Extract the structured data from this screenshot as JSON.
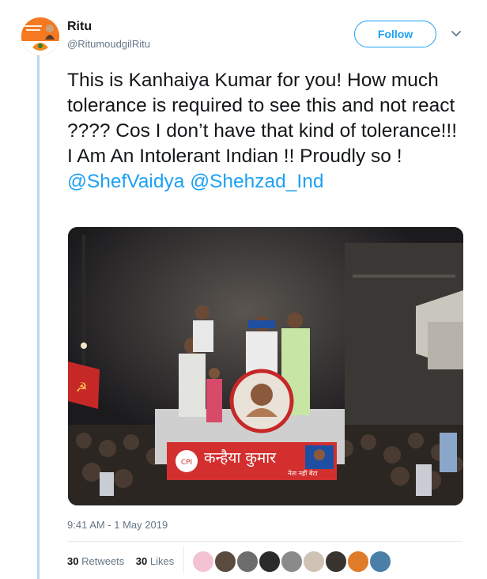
{
  "author": {
    "name": "Ritu",
    "handle": "@RitumoudgilRitu"
  },
  "follow_label": "Follow",
  "tweet": {
    "text": "This is Kanhaiya Kumar for you! How much tolerance is required to see this and not react ???? Cos I don’t have that kind of tolerance!!! I Am An Intolerant Indian !! Proudly so ! ",
    "mention_1": "@ShefVaidya",
    "mention_2": "@Shehzad_Ind"
  },
  "photo": {
    "banner_text": "कन्हैया कुमार",
    "banner_sub": "नेता नहीं बेटा",
    "party_label": "CPI"
  },
  "timestamp": "9:41 AM - 1 May 2019",
  "stats": {
    "retweets_count": "30",
    "retweets_label": "Retweets",
    "likes_count": "30",
    "likes_label": "Likes"
  },
  "colors": {
    "accent": "#1da1f2",
    "text": "#14171a",
    "muted": "#657786"
  }
}
